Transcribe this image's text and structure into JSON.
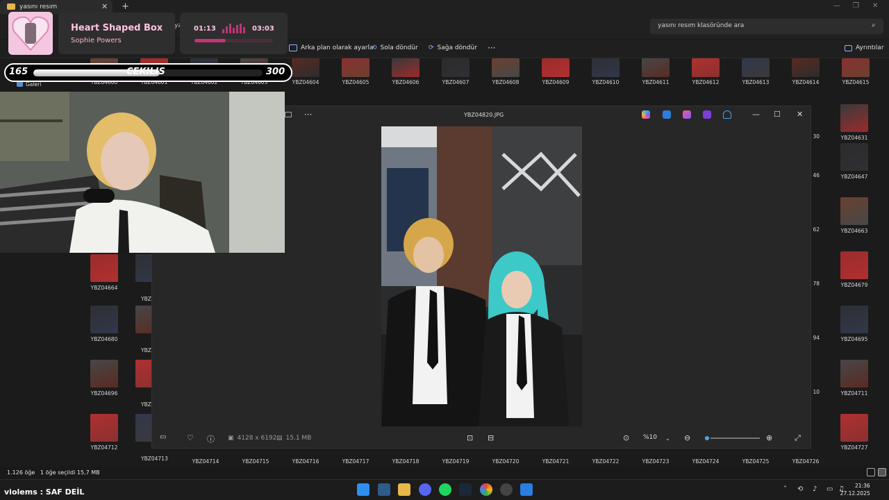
{
  "window": {
    "tab_title": "yasını resım",
    "search_placeholder": "yasını resım klasöründe ara",
    "partial_address": "ya"
  },
  "toolbar": {
    "set_background": "Arka plan olarak ayarla",
    "rotate_left": "Sola döndür",
    "rotate_right": "Sağa döndür",
    "more": "···",
    "details": "Ayrıntılar"
  },
  "sidebar": {
    "gallery": "Galeri"
  },
  "thumbnails": {
    "row1": [
      "YBZ04604",
      "YBZ04605",
      "YBZ04606",
      "YBZ04607",
      "YBZ04608",
      "YBZ04609",
      "YBZ04610",
      "YBZ04611",
      "YBZ04612",
      "YBZ04613",
      "YBZ04614",
      "YBZ04615"
    ],
    "row1_overlay": [
      "YBZ04600",
      "YBZ04601",
      "YBZ04602",
      "YBZ04603"
    ],
    "right_col": [
      "YBZ04631",
      "YBZ04647",
      "YBZ04663",
      "YBZ04679",
      "YBZ04695",
      "YBZ04711",
      "YBZ04727"
    ],
    "right_partial": [
      "30",
      "46",
      "62",
      "78",
      "94",
      "10"
    ],
    "left_col": [
      "YBZ04664",
      "YBZ04680",
      "YBZ04696",
      "YBZ04712"
    ],
    "left_col2": [
      "YBZ0",
      "YBZ",
      "YBZ",
      "YBZ04713"
    ],
    "bottom_row": [
      "YBZ04714",
      "YBZ04715",
      "YBZ04716",
      "YBZ04717",
      "YBZ04718",
      "YBZ04719",
      "YBZ04720",
      "YBZ04721",
      "YBZ04722",
      "YBZ04723",
      "YBZ04724",
      "YBZ04725",
      "YBZ04726"
    ]
  },
  "status": {
    "items": "1.126 öğe",
    "selected": "1 öğe seçildi  15,7 MB"
  },
  "viewer": {
    "filename": "YBZ04820.JPG",
    "dimensions": "4128 x 6192",
    "file_size": "15.1 MB",
    "zoom": "%10",
    "zoom_fraction": 0.05
  },
  "music": {
    "title": "Heart Shaped Box",
    "artist": "Sophie Powers",
    "current_time": "01:13",
    "total_time": "03:03",
    "progress_fraction": 0.4
  },
  "giveaway": {
    "current": "165",
    "label": "CEKILIS",
    "max": "300",
    "fraction": 0.55
  },
  "chat": {
    "message": "violems : SAF DEİL"
  },
  "clock": {
    "time": "21:36",
    "date": "27.12.2025"
  }
}
